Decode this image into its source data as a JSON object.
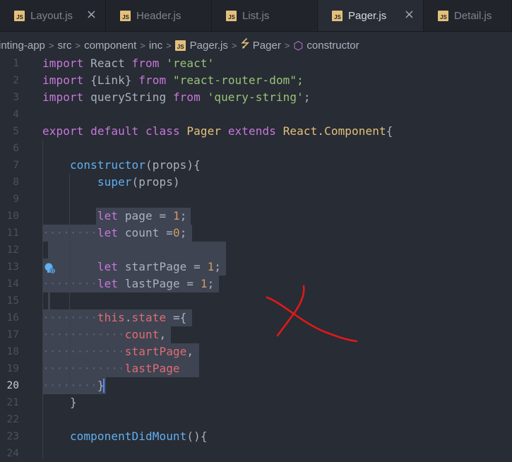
{
  "tabs": [
    {
      "label": "Layout.js",
      "icon": "js-file-icon",
      "close": "×"
    },
    {
      "label": "Header.js",
      "icon": "js-file-icon"
    },
    {
      "label": "List.js",
      "icon": "js-file-icon"
    },
    {
      "label": "Pager.js",
      "icon": "js-file-icon",
      "close": "×",
      "active": true
    },
    {
      "label": "Detail.js",
      "icon": "js-file-icon"
    }
  ],
  "js_badge": "JS",
  "breadcrumb": {
    "root": "inting-app",
    "src": "src",
    "component": "component",
    "inc": "inc",
    "file": "Pager.js",
    "class": "Pager",
    "method": "constructor",
    "separator": ">"
  },
  "editor": {
    "current_line": 20,
    "line_numbers": [
      "1",
      "2",
      "3",
      "4",
      "5",
      "6",
      "7",
      "8",
      "9",
      "10",
      "11",
      "12",
      "13",
      "14",
      "15",
      "16",
      "17",
      "18",
      "19",
      "20",
      "21",
      "22",
      "23",
      "24"
    ],
    "tokens": {
      "import": "import",
      "from": "from",
      "React": "React",
      "react_str": "'react'",
      "link_braces": "{Link}",
      "router_str": "\"react-router-dom\";",
      "queryString": "queryString",
      "qs_str": "'query-string'",
      "semicolon": ";",
      "export": "export",
      "default": "default",
      "class": "class",
      "Pager": "Pager",
      "extends": "extends",
      "ReactDot": "React.",
      "Component": "Component",
      "open_brace": "{",
      "constructor": "constructor",
      "props_paren": "(props){",
      "super": "super",
      "super_args": "(props)",
      "let": "let",
      "page": "page",
      "eq": "=",
      "one": "1",
      "count": "count",
      "eq_nosp": "=",
      "zero": "0",
      "startPage": "startPage",
      "lastPage": "lastPage",
      "this": "this",
      "dot": ".",
      "state": "state",
      "state_open": "={",
      "count_comma": "count",
      "comma": ",",
      "close_brace": "}",
      "componentDidMount": "componentDidMount",
      "cdm_tail": "(){"
    }
  },
  "colors": {
    "background": "#282c34",
    "keyword": "#c678dd",
    "string": "#98c379",
    "class": "#e5c07b",
    "function": "#61afef",
    "variable": "#e06c75",
    "number": "#d19a66",
    "annotation_mark": "#e0191b"
  }
}
